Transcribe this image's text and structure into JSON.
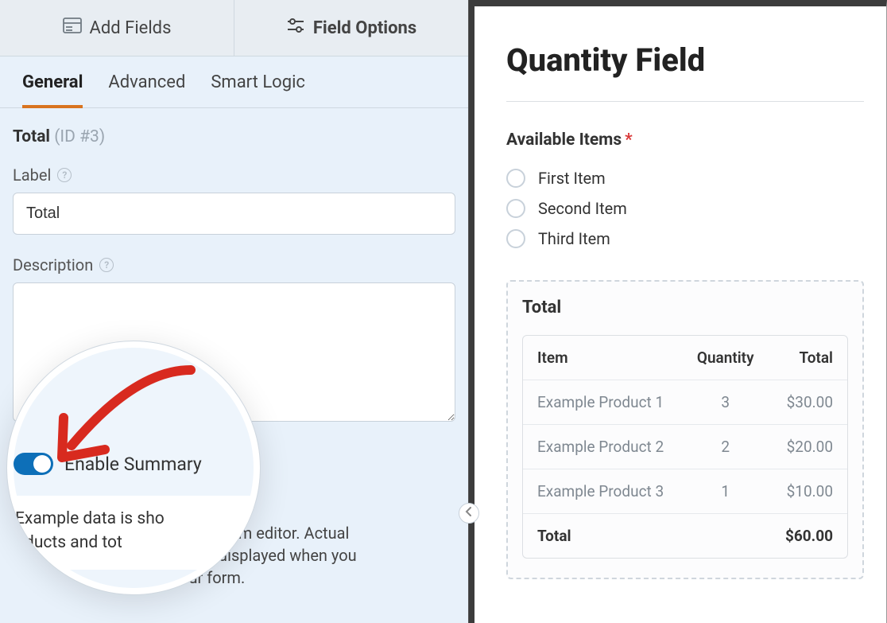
{
  "topTabs": {
    "addFields": "Add Fields",
    "fieldOptions": "Field Options"
  },
  "subTabs": {
    "general": "General",
    "advanced": "Advanced",
    "smartLogic": "Smart Logic"
  },
  "field": {
    "name": "Total",
    "id": "(ID #3)"
  },
  "labelSection": {
    "label": "Label",
    "value": "Total"
  },
  "descriptionSection": {
    "label": "Description",
    "value": ""
  },
  "zoom": {
    "toggleLabel": "Enable Summary",
    "infoLine1": "Example data is sho",
    "infoLine2Prefix": "",
    "infoLine2Suffix": "oducts and tot"
  },
  "tail": {
    "l1": "he form editor. Actual",
    "l2": "be displayed when you",
    "l3": "our form."
  },
  "preview": {
    "title": "Quantity Field",
    "availableLabel": "Available Items",
    "items": [
      "First Item",
      "Second Item",
      "Third Item"
    ],
    "totalTitle": "Total",
    "headers": {
      "item": "Item",
      "qty": "Quantity",
      "total": "Total"
    },
    "rows": [
      {
        "item": "Example Product 1",
        "qty": "3",
        "total": "$30.00"
      },
      {
        "item": "Example Product 2",
        "qty": "2",
        "total": "$20.00"
      },
      {
        "item": "Example Product 3",
        "qty": "1",
        "total": "$10.00"
      }
    ],
    "grandTotalLabel": "Total",
    "grandTotalValue": "$60.00"
  }
}
